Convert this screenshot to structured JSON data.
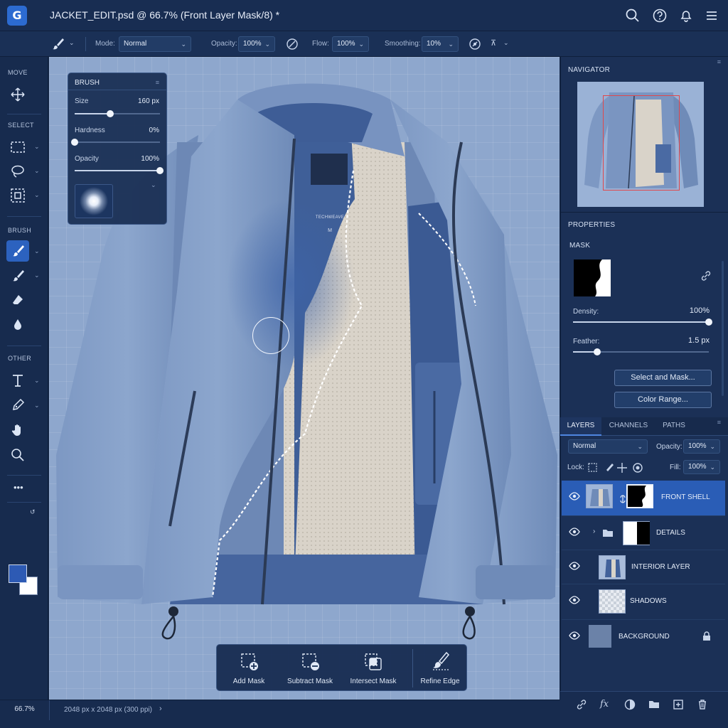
{
  "app": {
    "logo_letter": "G",
    "doc_title": "JACKET_EDIT.psd @ 66.7% (Front Layer Mask/8) *"
  },
  "top_icons": [
    "search-icon",
    "help-icon",
    "bell-icon",
    "menu-icon"
  ],
  "options": {
    "mode_label": "Mode:",
    "mode_value": "Normal",
    "opacity_label": "Opacity:",
    "opacity_value": "100%",
    "flow_label": "Flow:",
    "flow_value": "100%",
    "smoothing_label": "Smoothing:",
    "smoothing_value": "10%"
  },
  "toolbar": {
    "sections": {
      "move": "MOVE",
      "select": "SELECT",
      "brush": "BRUSH",
      "other": "OTHER"
    },
    "tools": [
      "move-tool",
      "rect-marquee-tool",
      "lasso-tool",
      "object-select-tool",
      "brush-tool",
      "mixer-brush-tool",
      "eraser-tool",
      "blur-tool",
      "type-tool",
      "pen-tool",
      "hand-tool",
      "zoom-tool",
      "more-tools"
    ],
    "more": "•••",
    "foreground_color": "#2d5ab4",
    "background_color": "#ffffff"
  },
  "brush_panel": {
    "title": "BRUSH",
    "size_label": "Size",
    "size_value": "160 px",
    "size_level": 0.42,
    "hardness_label": "Hardness",
    "hardness_value": "0%",
    "hardness_level": 0.0,
    "opacity_label": "Opacity",
    "opacity_value": "100%",
    "opacity_level": 1.0
  },
  "canvas": {
    "label_brand": "TECHWEAVE",
    "label_size": "M"
  },
  "mask_bar": {
    "add": "Add Mask",
    "subtract": "Subtract Mask",
    "intersect": "Intersect Mask",
    "refine": "Refine Edge"
  },
  "status": {
    "zoom": "66.7%",
    "doc_info": "2048 px x 2048 px (300 ppi)"
  },
  "navigator": {
    "title": "NAVIGATOR"
  },
  "properties": {
    "title": "PROPERTIES",
    "section": "MASK",
    "density_label": "Density:",
    "density_value": "100%",
    "density_level": 1.0,
    "feather_label": "Feather:",
    "feather_value": "1.5 px",
    "feather_level": 0.18,
    "select_and_mask": "Select and Mask...",
    "color_range": "Color Range..."
  },
  "layers_panel": {
    "tabs": [
      "LAYERS",
      "CHANNELS",
      "PATHS"
    ],
    "blend_mode": "Normal",
    "opacity_label": "Opacity:",
    "opacity_value": "100%",
    "lock_label": "Lock:",
    "fill_label": "Fill:",
    "fill_value": "100%",
    "layers": [
      {
        "name": "FRONT SHELL",
        "selected": true
      },
      {
        "name": "DETAILS",
        "selected": false
      },
      {
        "name": "INTERIOR LAYER",
        "selected": false
      },
      {
        "name": "SHADOWS",
        "selected": false
      },
      {
        "name": "BACKGROUND",
        "selected": false
      }
    ]
  },
  "colors": {
    "accent": "#2c62bf",
    "selection_outline": "#e0484c",
    "jacket": "#7f9ac4",
    "lining": "#d9d4cc"
  }
}
